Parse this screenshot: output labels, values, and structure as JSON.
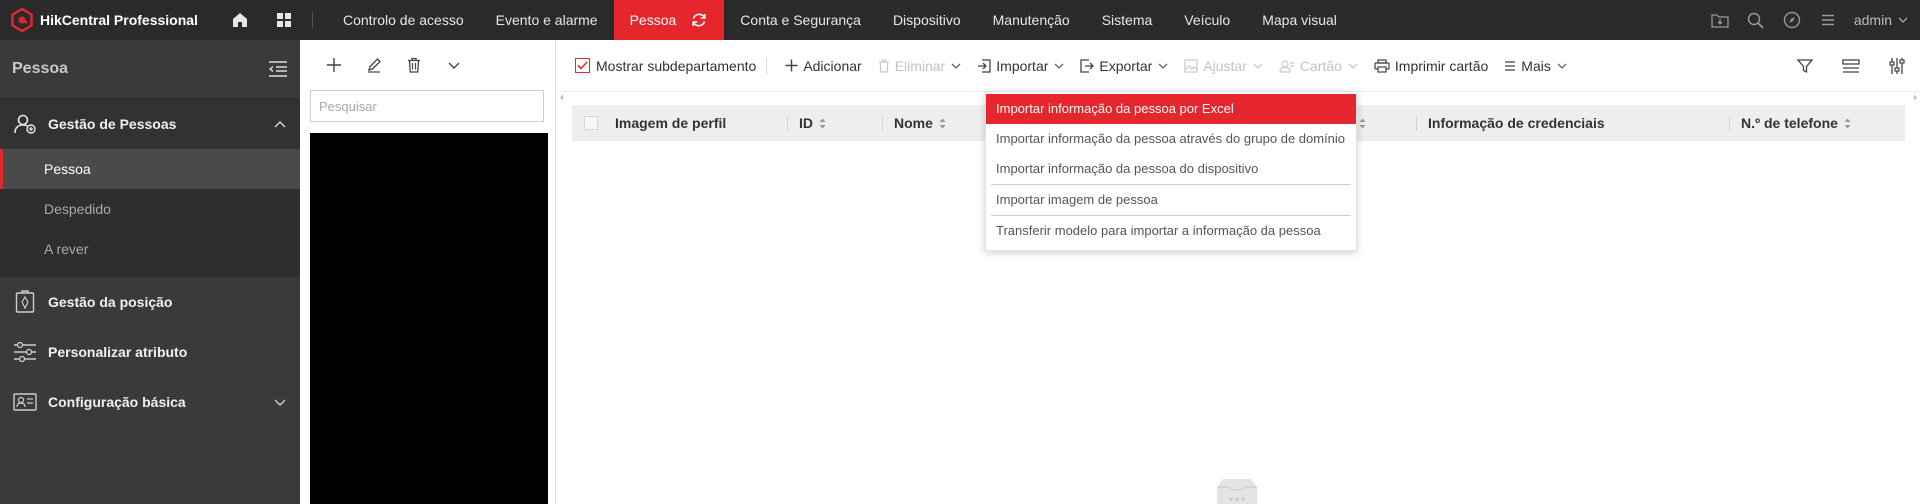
{
  "app": {
    "brand": "HikCentral Professional",
    "accent_color": "#e5262d",
    "topbar_color": "#2b2b2b"
  },
  "topnav": {
    "items": [
      {
        "label": "Controlo de acesso",
        "active": false
      },
      {
        "label": "Evento e alarme",
        "active": false
      },
      {
        "label": "Pessoa",
        "active": true
      },
      {
        "label": "Conta e Segurança",
        "active": false
      },
      {
        "label": "Dispositivo",
        "active": false
      },
      {
        "label": "Manutenção",
        "active": false
      },
      {
        "label": "Sistema",
        "active": false
      },
      {
        "label": "Veículo",
        "active": false
      },
      {
        "label": "Mapa visual",
        "active": false
      }
    ],
    "user": "admin",
    "right_icons": [
      "download-center-icon",
      "search-icon",
      "compass-icon",
      "menu-icon"
    ]
  },
  "sidebar": {
    "title": "Pessoa",
    "groups": [
      {
        "label": "Gestão de Pessoas",
        "icon": "person-icon",
        "expanded": true,
        "items": [
          {
            "label": "Pessoa",
            "active": true
          },
          {
            "label": "Despedido",
            "active": false
          },
          {
            "label": "A rever",
            "active": false
          }
        ]
      },
      {
        "label": "Gestão da posição",
        "icon": "badge-icon",
        "expanded": false
      },
      {
        "label": "Personalizar atributo",
        "icon": "sliders-icon",
        "expanded": false
      },
      {
        "label": "Configuração básica",
        "icon": "config-icon",
        "expanded": false
      }
    ]
  },
  "tree": {
    "tools": [
      "add-icon",
      "edit-icon",
      "delete-icon",
      "chevron-down-icon"
    ],
    "search_placeholder": "Pesquisar"
  },
  "toolbar": {
    "show_subdepartment": {
      "label": "Mostrar subdepartamento",
      "checked": true
    },
    "add": "Adicionar",
    "delete": "Eliminar",
    "import": "Importar",
    "export": "Exportar",
    "adjust": "Ajustar",
    "card": "Cartão",
    "print_card": "Imprimir cartão",
    "more": "Mais"
  },
  "table": {
    "columns": [
      {
        "label": "Imagem de perfil",
        "sortable": false
      },
      {
        "label": "ID",
        "sortable": true
      },
      {
        "label": "Nome",
        "sortable": true
      },
      {
        "label": "",
        "sortable": true
      },
      {
        "label": "Informação de credenciais",
        "sortable": false
      },
      {
        "label": "N.º de telefone",
        "sortable": true
      }
    ],
    "rows": []
  },
  "import_menu": {
    "items": [
      {
        "label": "Importar informação da pessoa por Excel",
        "highlighted": true
      },
      {
        "label": "Importar informação da pessoa através do grupo de domínio",
        "highlighted": false
      },
      {
        "label": "Importar informação da pessoa do dispositivo",
        "highlighted": false
      },
      {
        "label": "Importar imagem de pessoa",
        "highlighted": false
      },
      {
        "label": "Transferir modelo para importar a informação da pessoa",
        "highlighted": false
      }
    ]
  }
}
